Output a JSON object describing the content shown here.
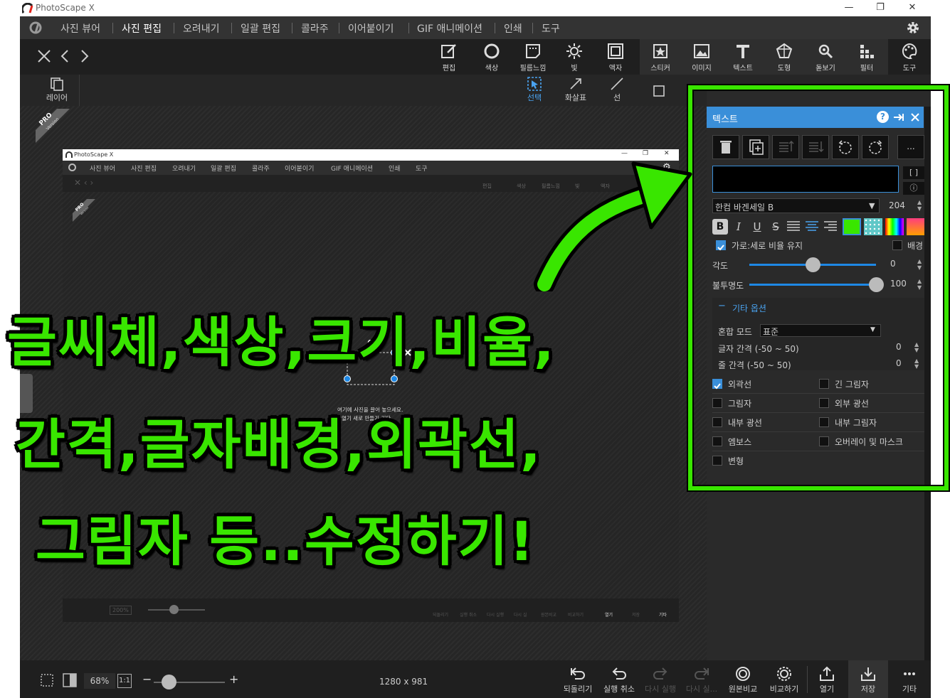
{
  "window": {
    "title": "PhotoScape X",
    "minimize": "—",
    "restore": "❐",
    "close": "✕"
  },
  "menu": [
    "사진 뷰어",
    "사진 편집",
    "오려내기",
    "일괄 편집",
    "콜라주",
    "이어붙이기",
    "GIF 애니메이션",
    "인쇄",
    "도구"
  ],
  "menu_active": "사진 편집",
  "toolbar": {
    "tools": [
      "편집",
      "색상",
      "필름느낌",
      "빛",
      "액자",
      "스티커",
      "이미지",
      "텍스트",
      "도형",
      "돋보기",
      "필터",
      "도구"
    ]
  },
  "subbar": {
    "layer": "레이어",
    "select": "선택",
    "arrow": "화살표",
    "line": "선",
    "pro": "PRO",
    "pro_sub": "Version"
  },
  "panel": {
    "title": "텍스트",
    "bracket": "[ ]",
    "info": "ⓘ",
    "more": "...",
    "font": "한컴 바겐세일 B",
    "font_size": "204",
    "format": [
      "B",
      "I",
      "U",
      "S"
    ],
    "keep_ratio": "가로:세로 비율 유지",
    "background": "배경",
    "angle_label": "각도",
    "angle_value": "0",
    "angle_level": 0.5,
    "opacity_label": "불투명도",
    "opacity_value": "100",
    "opacity_level": 1.0,
    "other_options": "기타 옵션",
    "blend_label": "혼합 모드",
    "blend_value": "표준",
    "letter_spacing": "글자 간격 (-50 ~ 50)",
    "letter_spacing_value": "0",
    "line_spacing": "줄 간격 (-50 ~ 50)",
    "line_spacing_value": "0",
    "effects": [
      {
        "label": "외곽선",
        "checked": true
      },
      {
        "label": "긴 그림자",
        "checked": false
      },
      {
        "label": "그림자",
        "checked": false
      },
      {
        "label": "외부 광선",
        "checked": false
      },
      {
        "label": "내부 광선",
        "checked": false
      },
      {
        "label": "내부 그림자",
        "checked": false
      },
      {
        "label": "엠보스",
        "checked": false
      },
      {
        "label": "오버레이 및 마스크",
        "checked": false
      },
      {
        "label": "변형",
        "checked": false
      }
    ],
    "colors": {
      "text": "#39e600",
      "accent": "#3a8fd9"
    }
  },
  "status": {
    "zoom": "68%",
    "one_to_one": "1:1",
    "minus": "−",
    "plus": "+",
    "dimensions": "1280 x 981",
    "buttons": [
      "되돌리기",
      "실행 취소",
      "다시 실행",
      "다시 실...",
      "원본비교",
      "비교하기",
      "열기",
      "저장",
      "기타"
    ]
  },
  "inner": {
    "title": "PhotoScape X",
    "menu": [
      "사진 뷰어",
      "사진 편집",
      "오려내기",
      "일괄 편집",
      "콜라주",
      "이어붙이기",
      "GIF 애니메이션",
      "인쇄",
      "도구"
    ],
    "tools": [
      "편집",
      "색상",
      "필름느낌",
      "빛",
      "액자"
    ],
    "pro": "PRO",
    "pro_sub": "Version",
    "placeholder_line1": "여기에 사진을 끌어 놓으세요.",
    "placeholder_line2": "열기  새로 만들기  기타",
    "zoom": "200%",
    "status_buttons": [
      "되돌리기",
      "실행 취소",
      "다시 실행",
      "다시 실",
      "원본비교",
      "비교하기",
      "열기",
      "저장",
      "기타"
    ]
  },
  "overlay": {
    "line1": "글씨체,색상,크기,비율,",
    "line2": "간격,글자배경,외곽선,",
    "line3": "그림자 등..수정하기!",
    "color": "#39e600"
  }
}
